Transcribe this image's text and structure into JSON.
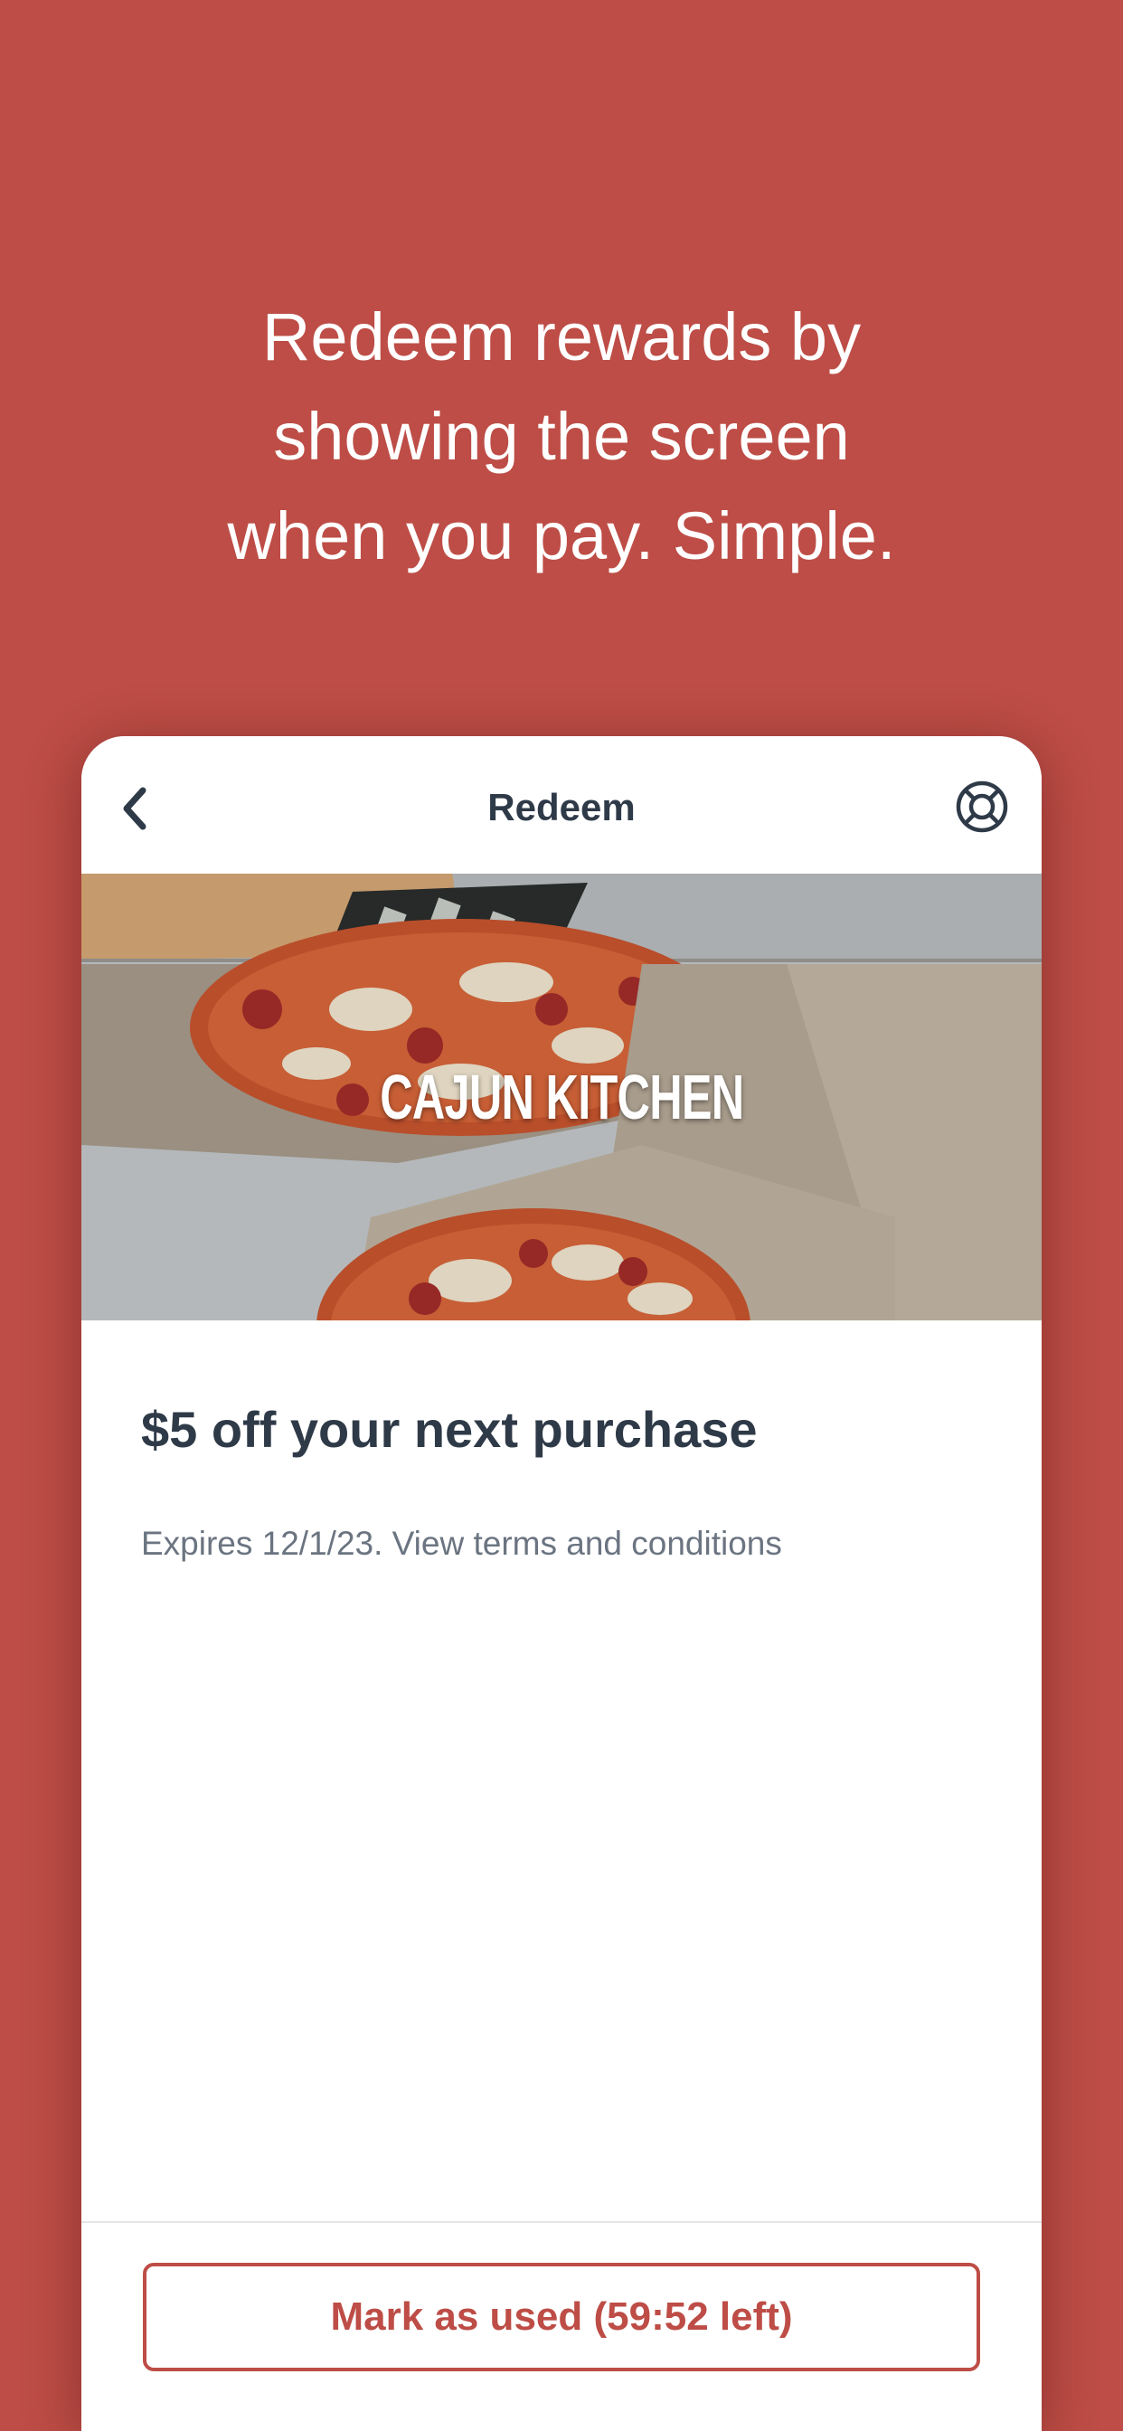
{
  "promo": {
    "headline": "Redeem rewards by\nshowing the screen\nwhen you pay. Simple."
  },
  "nav": {
    "title": "Redeem",
    "back_icon": "chevron-left-icon",
    "help_icon": "lifebuoy-icon"
  },
  "hero": {
    "brand_name": "CAJUN KITCHEN"
  },
  "reward": {
    "title": "$5 off your next purchase",
    "expiry": "Expires 12/1/23.",
    "terms_link": "View terms and conditions"
  },
  "actions": {
    "mark_used_label": "Mark as used (59:52 left)"
  },
  "colors": {
    "background": "#bd4d46",
    "accent": "#bd4d46",
    "text_primary": "#2f3a48",
    "text_secondary": "#6b7481"
  }
}
